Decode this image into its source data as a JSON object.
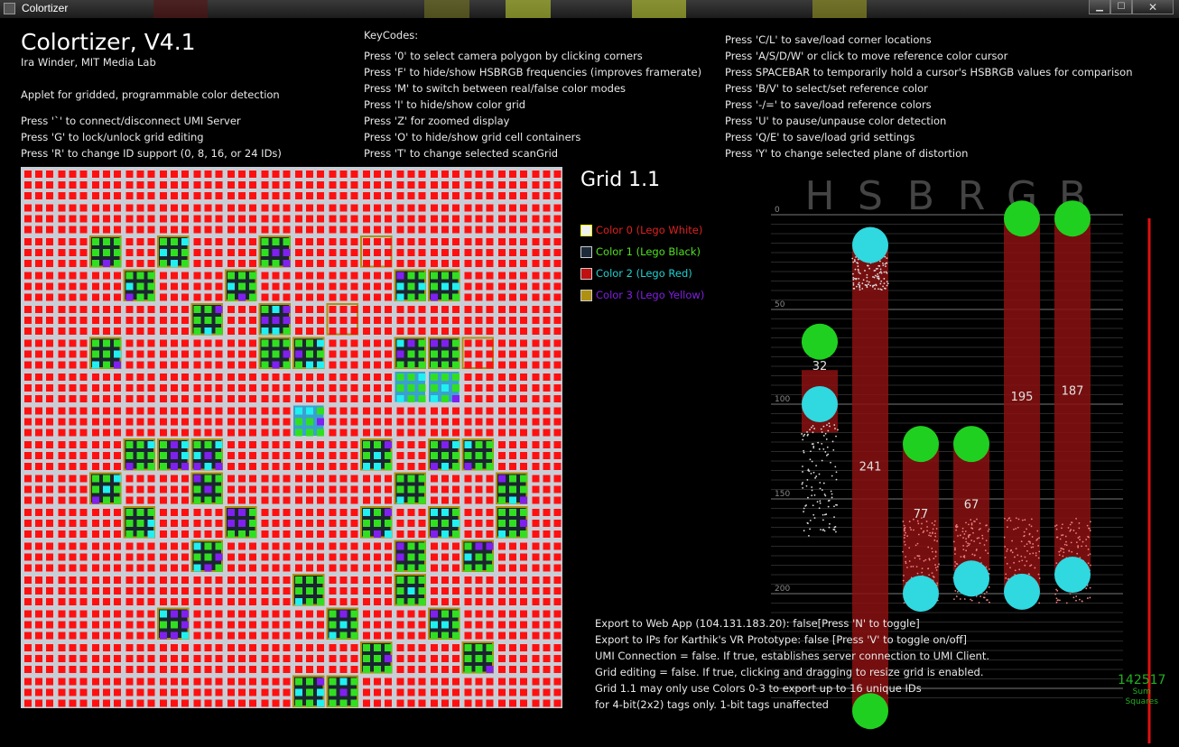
{
  "window": {
    "title": "Colortizer"
  },
  "header": {
    "title": "Colortizer, V4.1",
    "author": "Ira Winder, MIT Media Lab",
    "description": "Applet for gridded, programmable color detection",
    "commands": [
      "Press '`' to connect/disconnect UMI Server",
      "Press 'G' to lock/unlock grid editing",
      "Press 'R' to change ID support (0, 8, 16, or 24 IDs)"
    ]
  },
  "keycodes": {
    "heading": "KeyCodes:",
    "col1": [
      "Press '0' to select camera polygon by clicking corners",
      "Press 'F' to hide/show HSBRGB frequencies (improves framerate)",
      "Press 'M' to switch between real/false color modes",
      "Press 'I' to hide/show color grid",
      "Press 'Z' for zoomed display",
      "Press 'O' to hide/show grid cell containers",
      "Press 'T' to change selected scanGrid"
    ],
    "col2": [
      "Press 'C/L' to save/load corner locations",
      "Press 'A/S/D/W' or click to move reference color cursor",
      "Press SPACEBAR to temporarily hold a cursor's HSBRGB values for comparison",
      "Press 'B/V' to select/set reference color",
      "Press '-/=' to save/load reference colors",
      "Press 'U' to pause/unpause color detection",
      "Press 'Q/E' to save/load grid settings",
      "Press 'Y' to change selected plane of distortion"
    ]
  },
  "grid": {
    "label": "Grid 1.1",
    "legend": [
      {
        "label": "Color 0 (Lego White)",
        "swatch": "#f0f000",
        "text_color": "#e02020",
        "border": "#f0f000"
      },
      {
        "label": "Color 1 (Lego Black)",
        "swatch": "#1c2a3a",
        "text_color": "#50e020",
        "border": "#9aa0a8"
      },
      {
        "label": "Color 2 (Lego Red)",
        "swatch": "#c01010",
        "text_color": "#20d0d0",
        "border": "#9aa0a8"
      },
      {
        "label": "Color 3 (Lego Yellow)",
        "swatch": "#b09010",
        "text_color": "#8020e0",
        "border": "#9aa0a8"
      }
    ],
    "colors": {
      "red": "#ff1010",
      "green": "#30e020",
      "cyan": "#20f0f0",
      "purple": "#8020f0",
      "cell_bg": "#b6bcc4"
    }
  },
  "hsbrgb": {
    "channels": [
      "H",
      "S",
      "B",
      "R",
      "G",
      "B"
    ],
    "ticks": [
      "0",
      "50",
      "100",
      "150",
      "200"
    ],
    "reference_values": [
      32,
      241,
      77,
      67,
      195,
      187
    ],
    "colors": {
      "bar": "#8a1010",
      "green_cursor": "#20d020",
      "cyan_cursor": "#30d8e0",
      "red_line": "#e01010"
    }
  },
  "status": [
    "Export to Web App (104.131.183.20): false[Press 'N' to toggle]",
    "Export to IPs for Karthik's VR Prototype: false [Press 'V' to toggle on/off]",
    "UMI Connection = false. If true, establishes server connection to UMI Client.",
    "Grid editing = false. If true, clicking and dragging to resize grid is enabled.",
    "Grid 1.1 may only use Colors 0-3 to export up to 16 unique IDs",
    "for 4-bit(2x2) tags only.  1-bit tags unaffected"
  ],
  "sum": {
    "value": "142517",
    "label1": "Sum",
    "label2": "Squares"
  }
}
